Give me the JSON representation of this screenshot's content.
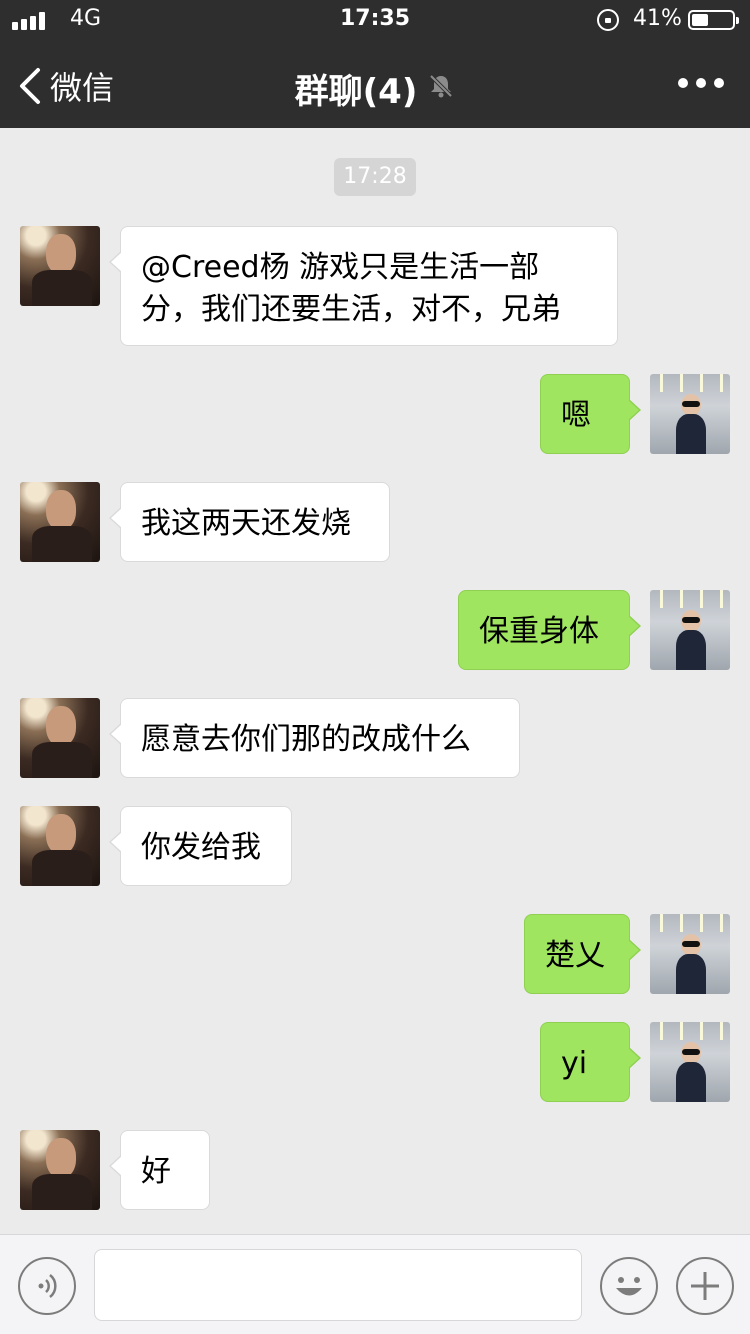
{
  "status_bar": {
    "network": "4G",
    "time": "17:35",
    "battery_percent": "41%",
    "battery_level": 0.41
  },
  "header": {
    "back_label": "微信",
    "title": "群聊(4)",
    "muted": true
  },
  "chat": {
    "timestamp": "17:28",
    "messages": [
      {
        "side": "left",
        "text": "@Creed杨 游戏只是生活一部\n分，我们还要生活，对不，兄弟"
      },
      {
        "side": "right",
        "text": "嗯"
      },
      {
        "side": "left",
        "text": "我这两天还发烧"
      },
      {
        "side": "right",
        "text": "保重身体"
      },
      {
        "side": "left",
        "text": "愿意去你们那的改成什么"
      },
      {
        "side": "left",
        "text": "你发给我"
      },
      {
        "side": "right",
        "text": "楚乂"
      },
      {
        "side": "right",
        "text": "yi"
      },
      {
        "side": "left",
        "text": "好"
      }
    ]
  },
  "colors": {
    "header_bg": "#2e2e2e",
    "chat_bg": "#ebebeb",
    "outgoing_bubble": "#9fe55f",
    "incoming_bubble": "#ffffff"
  },
  "input_bar": {
    "voice_icon": "voice-icon",
    "emoji_icon": "emoji-icon",
    "plus_icon": "plus-icon",
    "text_value": ""
  }
}
